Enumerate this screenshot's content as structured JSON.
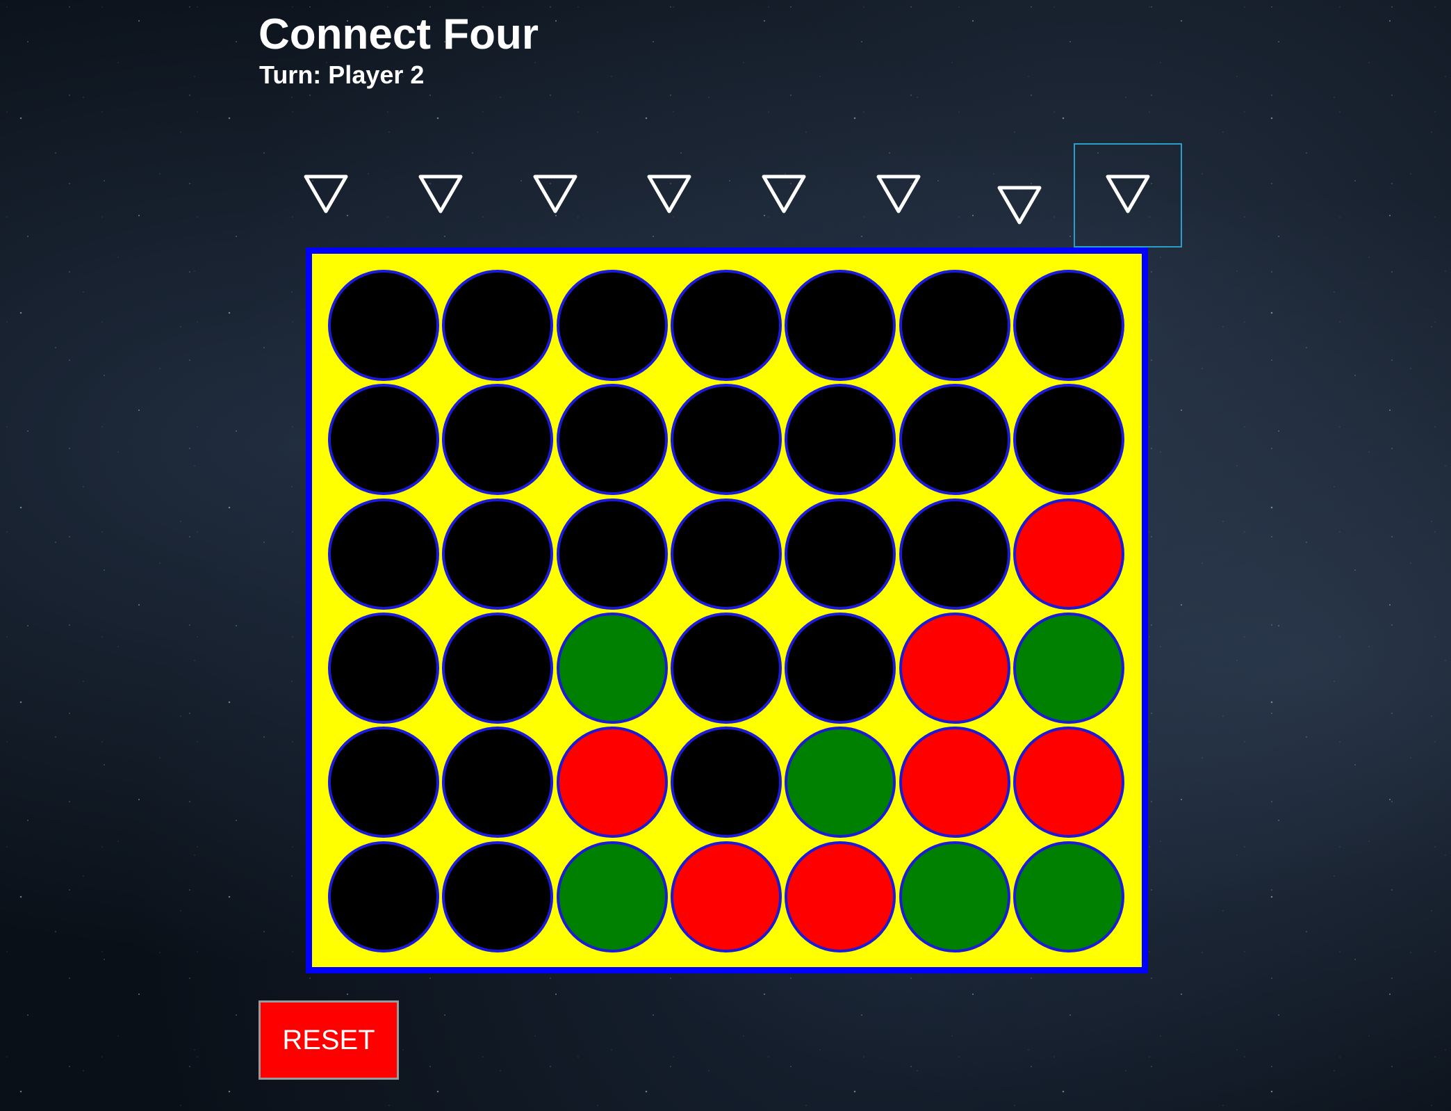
{
  "header": {
    "title": "Connect Four",
    "turn_text": "Turn: Player 2"
  },
  "drop_controls": {
    "icon": "triangle-down-icon",
    "columns": 8,
    "selected_column": 8
  },
  "board": {
    "rows": 6,
    "columns": 7,
    "colors": {
      "board": "#ffff00",
      "frame": "#0000ff",
      "empty": "#000000",
      "player1": "#ff0000",
      "player2": "#008000",
      "hole_ring": "#1a1ad8"
    },
    "cells": [
      [
        "empty",
        "empty",
        "empty",
        "empty",
        "empty",
        "empty",
        "empty"
      ],
      [
        "empty",
        "empty",
        "empty",
        "empty",
        "empty",
        "empty",
        "empty"
      ],
      [
        "empty",
        "empty",
        "empty",
        "empty",
        "empty",
        "empty",
        "red"
      ],
      [
        "empty",
        "empty",
        "green",
        "empty",
        "empty",
        "red",
        "green"
      ],
      [
        "empty",
        "empty",
        "red",
        "empty",
        "green",
        "red",
        "red"
      ],
      [
        "empty",
        "empty",
        "green",
        "red",
        "red",
        "green",
        "green"
      ]
    ]
  },
  "reset_button": {
    "label": "RESET",
    "color": "#ff0000"
  }
}
